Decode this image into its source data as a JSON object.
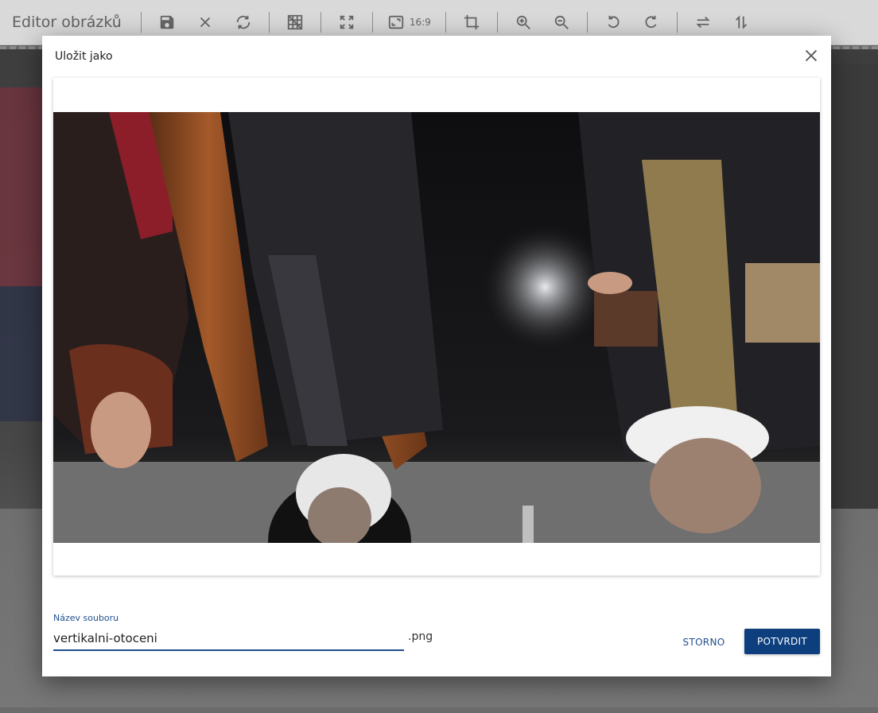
{
  "toolbar": {
    "title": "Editor obrázků",
    "ratio_label": "16:9",
    "icons": [
      "save-icon",
      "close-icon",
      "reset-icon",
      "grid-off-icon",
      "fullscreen-icon",
      "aspect-ratio-icon",
      "crop-icon",
      "zoom-in-icon",
      "zoom-out-icon",
      "rotate-left-icon",
      "rotate-right-icon",
      "flip-horizontal-icon",
      "flip-vertical-icon"
    ]
  },
  "dialog": {
    "title": "Uložit jako",
    "field_label": "Název souboru",
    "filename_value": "vertikalni-otoceni",
    "extension": ".png",
    "cancel_label": "STORNO",
    "confirm_label": "POTVRDIT"
  },
  "colors": {
    "accent": "#1f4e8c",
    "confirm_bg": "#0d3f7e",
    "toolbar_bg": "#d9d9d9"
  }
}
